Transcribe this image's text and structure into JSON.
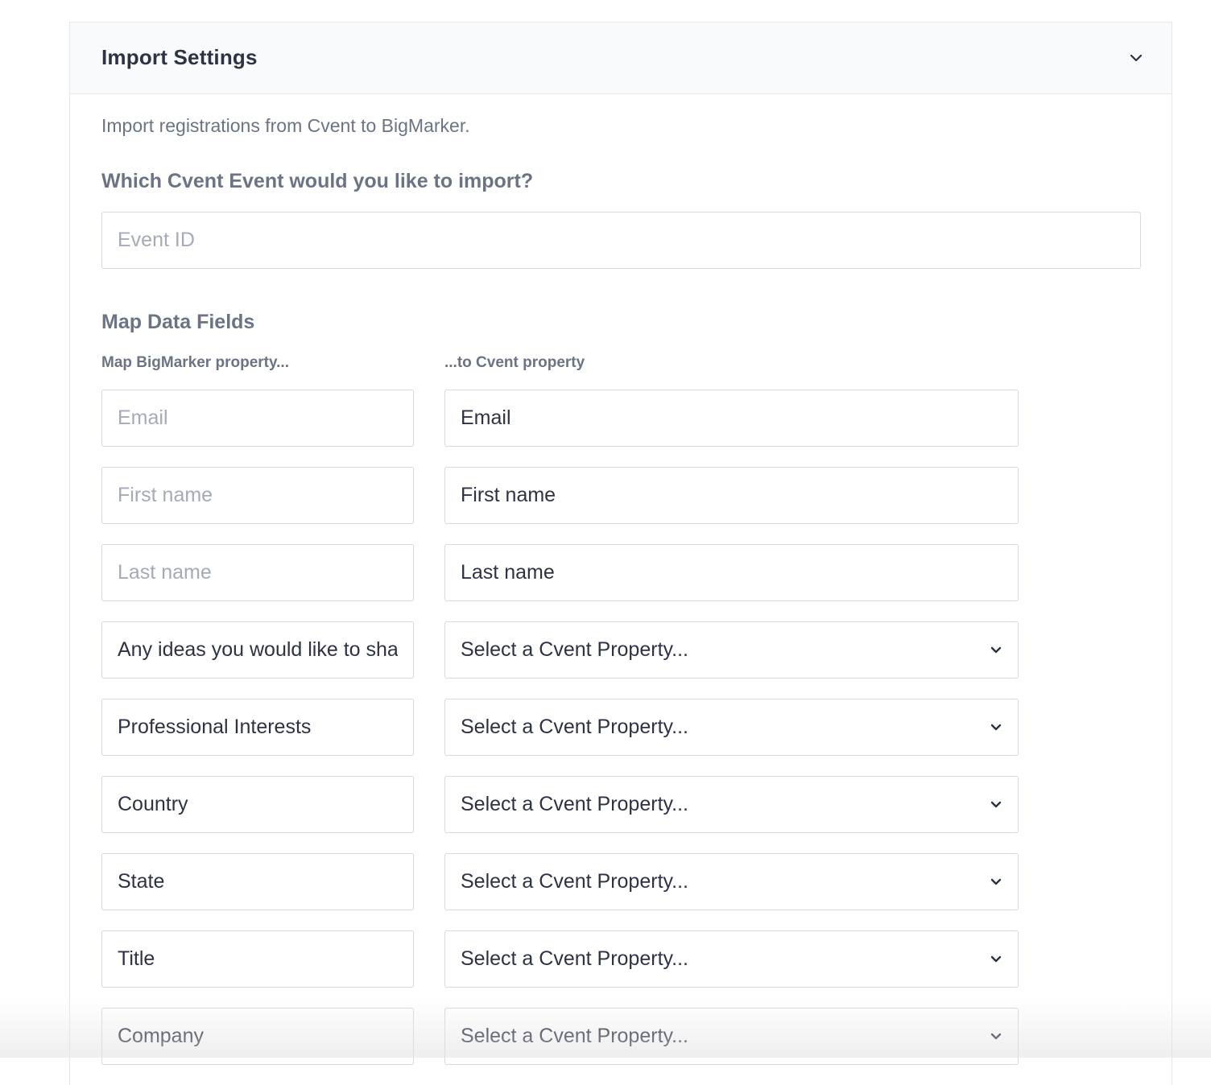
{
  "panel": {
    "title": "Import Settings",
    "toggle_icon": "chevron-down-icon"
  },
  "intro_text": "Import registrations from Cvent to BigMarker.",
  "event_question": "Which Cvent Event would you like to import?",
  "event_id": {
    "placeholder": "Event ID",
    "value": ""
  },
  "mapping": {
    "title": "Map Data Fields",
    "left_label": "Map BigMarker property...",
    "right_label": "...to Cvent property",
    "rows": [
      {
        "source_value": "",
        "source_placeholder": "Email",
        "target": "Email",
        "target_type": "text"
      },
      {
        "source_value": "",
        "source_placeholder": "First name",
        "target": "First name",
        "target_type": "text"
      },
      {
        "source_value": "",
        "source_placeholder": "Last name",
        "target": "Last name",
        "target_type": "text"
      },
      {
        "source_value": "Any ideas you would like to sha",
        "source_placeholder": "",
        "target": "Select a Cvent Property...",
        "target_type": "select"
      },
      {
        "source_value": "Professional Interests",
        "source_placeholder": "",
        "target": "Select a Cvent Property...",
        "target_type": "select"
      },
      {
        "source_value": "Country",
        "source_placeholder": "",
        "target": "Select a Cvent Property...",
        "target_type": "select"
      },
      {
        "source_value": "State",
        "source_placeholder": "",
        "target": "Select a Cvent Property...",
        "target_type": "select"
      },
      {
        "source_value": "Title",
        "source_placeholder": "",
        "target": "Select a Cvent Property...",
        "target_type": "select"
      },
      {
        "source_value": "Company",
        "source_placeholder": "",
        "target": "Select a Cvent Property...",
        "target_type": "select"
      }
    ]
  },
  "colors": {
    "title": "#2d3344",
    "muted": "#6b7385",
    "placeholder": "#a4abb7",
    "border": "#d5d9e0",
    "header_bg": "#f9fafb"
  }
}
